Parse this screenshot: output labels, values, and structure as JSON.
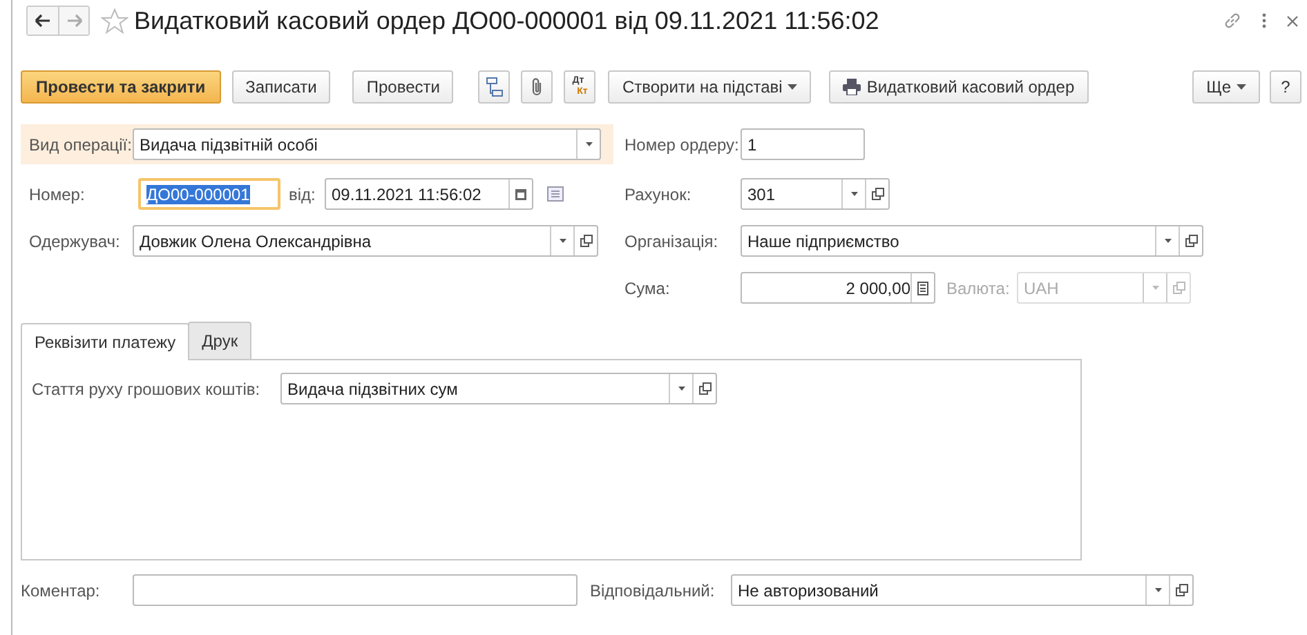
{
  "window": {
    "title": "Видатковий касовий ордер ДО00-000001 від 09.11.2021 11:56:02"
  },
  "toolbar": {
    "post_close": "Провести та закрити",
    "save": "Записати",
    "post": "Провести",
    "dt": "Дт",
    "kt": "Кт",
    "create_based": "Створити на підставі",
    "print": "Видатковий касовий ордер",
    "more": "Ще",
    "help": "?"
  },
  "operation": {
    "label": "Вид операції:",
    "value": "Видача підзвітній особі",
    "highlighted": true
  },
  "number": {
    "label": "Номер:",
    "value": "ДО00-000001",
    "focused": true
  },
  "date": {
    "label": "від:",
    "value": "09.11.2021 11:56:02"
  },
  "recipient": {
    "label": "Одержувач:",
    "value": "Довжик Олена Олександрівна"
  },
  "order_number": {
    "label": "Номер ордеру:",
    "value": "1"
  },
  "account": {
    "label": "Рахунок:",
    "value": "301"
  },
  "organization": {
    "label": "Організація:",
    "value": "Наше підприємство"
  },
  "amount": {
    "label": "Сума:",
    "value": "2 000,00"
  },
  "currency": {
    "label": "Валюта:",
    "value": "UAH",
    "disabled": true
  },
  "tabs": [
    {
      "label": "Реквізити платежу",
      "selected": true
    },
    {
      "label": "Друк",
      "selected": false
    }
  ],
  "cash_flow": {
    "label": "Стаття руху грошових коштів:",
    "value": "Видача підзвітних сум"
  },
  "comment": {
    "label": "Коментар:"
  },
  "responsible": {
    "label": "Відповідальний:",
    "value": "Не авторизований"
  }
}
